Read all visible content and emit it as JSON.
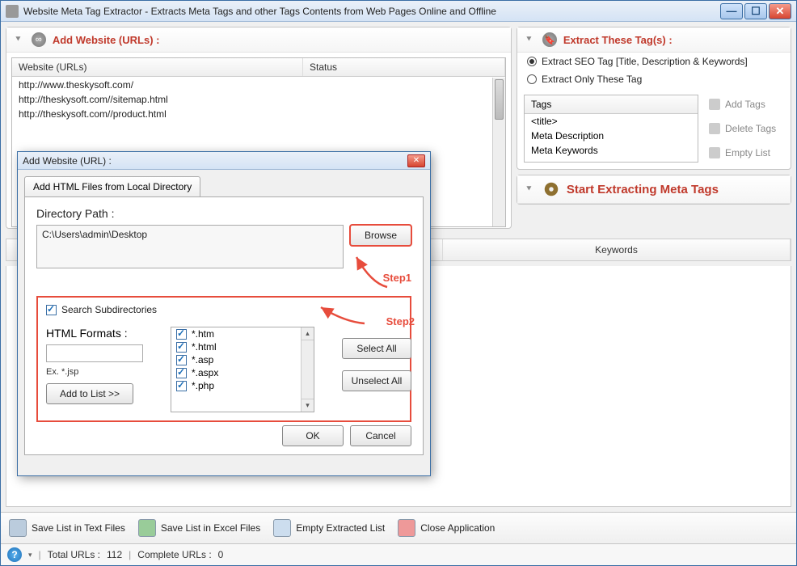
{
  "window": {
    "title": "Website Meta Tag Extractor - Extracts Meta Tags and other Tags Contents from Web Pages Online and Offline"
  },
  "add_urls": {
    "header": "Add Website (URLs) :",
    "col_url": "Website (URLs)",
    "col_status": "Status",
    "rows": [
      "http://www.theskysoft.com/",
      "http://theskysoft.com//sitemap.html",
      "http://theskysoft.com//product.html"
    ]
  },
  "extract_tags": {
    "header": "Extract These Tag(s) :",
    "radio_seo": "Extract SEO Tag [Title, Description & Keywords]",
    "radio_only": "Extract Only These Tag",
    "col_tags": "Tags",
    "rows": [
      "<title>",
      "Meta Description",
      "Meta Keywords"
    ],
    "btn_add": "Add Tags",
    "btn_delete": "Delete Tags",
    "btn_empty": "Empty List"
  },
  "start": {
    "label": "Start Extracting Meta Tags"
  },
  "results": {
    "col_keywords": "Keywords"
  },
  "toolbar": {
    "save_text": "Save List in Text Files",
    "save_excel": "Save List in Excel Files",
    "empty": "Empty Extracted List",
    "close": "Close Application"
  },
  "status": {
    "total_label": "Total URLs :",
    "total_value": "112",
    "complete_label": "Complete URLs :",
    "complete_value": "0"
  },
  "modal": {
    "title": "Add Website (URL) :",
    "tab": "Add HTML Files from Local Directory",
    "dir_label": "Directory Path :",
    "dir_value": "C:\\Users\\admin\\Desktop",
    "browse": "Browse",
    "step1": "Step1",
    "step2": "Step2",
    "search_sub": "Search Subdirectories",
    "formats_label": "HTML Formats :",
    "ex_label": "Ex. *.jsp",
    "add_to_list": "Add to List >>",
    "formats": [
      "*.htm",
      "*.html",
      "*.asp",
      "*.aspx",
      "*.php"
    ],
    "select_all": "Select All",
    "unselect_all": "Unselect All",
    "ok": "OK",
    "cancel": "Cancel"
  }
}
